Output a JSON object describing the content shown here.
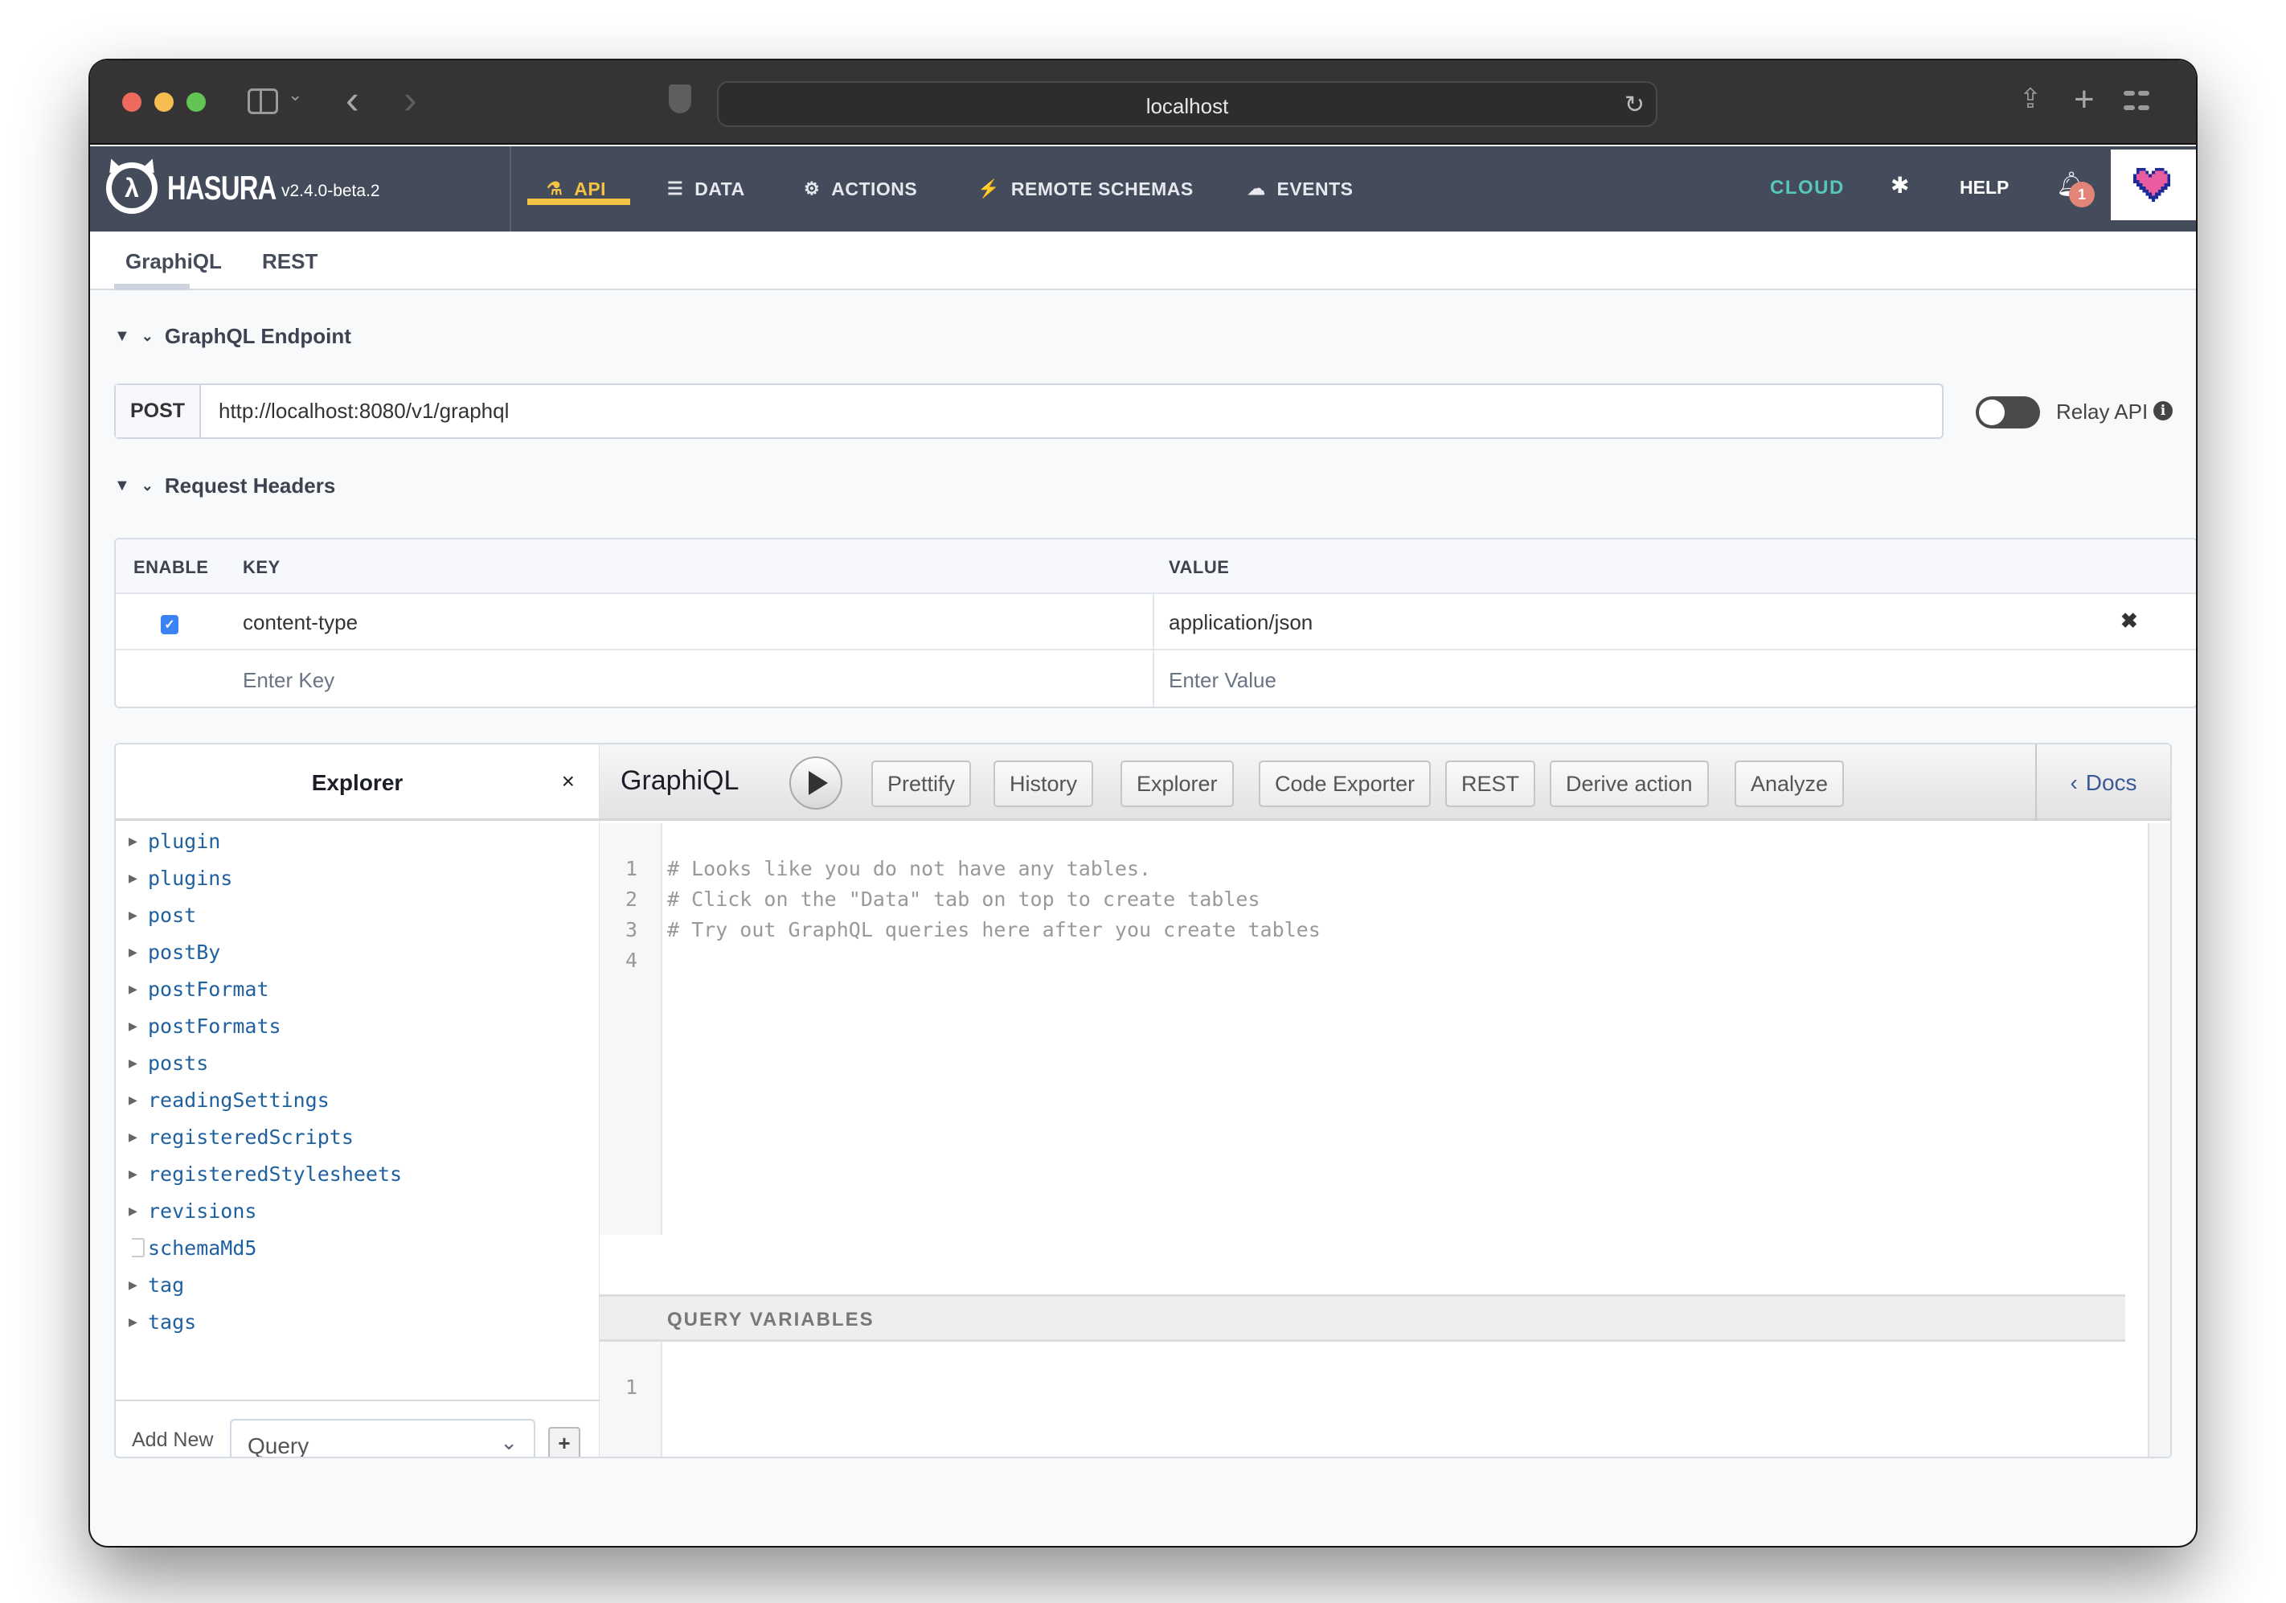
{
  "browser": {
    "url": "localhost",
    "icons": [
      "sidebar-toggle-icon",
      "chevron-down-icon",
      "back-icon",
      "forward-icon",
      "shield-icon",
      "reload-icon",
      "share-icon",
      "new-tab-icon",
      "tab-overview-icon"
    ]
  },
  "navbar": {
    "brand": "HASURA",
    "version": "v2.4.0-beta.2",
    "items": [
      {
        "label": "API",
        "icon": "flask-icon",
        "active": true
      },
      {
        "label": "DATA",
        "icon": "database-icon",
        "active": false
      },
      {
        "label": "ACTIONS",
        "icon": "cogs-icon",
        "active": false
      },
      {
        "label": "REMOTE SCHEMAS",
        "icon": "plug-icon",
        "active": false
      },
      {
        "label": "EVENTS",
        "icon": "cloud-icon",
        "active": false
      }
    ],
    "cloud": "CLOUD",
    "help": "HELP",
    "notification_count": "1",
    "accent": "#f5c344",
    "cloud_color": "#58c7bb"
  },
  "subtabs": [
    {
      "label": "GraphiQL",
      "active": true
    },
    {
      "label": "REST",
      "active": false
    }
  ],
  "endpoint": {
    "section_title": "GraphQL Endpoint",
    "method": "POST",
    "url": "http://localhost:8080/v1/graphql",
    "relay_label": "Relay API",
    "relay_enabled": false
  },
  "headers": {
    "section_title": "Request Headers",
    "columns": [
      "ENABLE",
      "KEY",
      "VALUE"
    ],
    "rows": [
      {
        "enabled": true,
        "key": "content-type",
        "value": "application/json"
      }
    ],
    "new_key_placeholder": "Enter Key",
    "new_value_placeholder": "Enter Value"
  },
  "explorer": {
    "title": "Explorer",
    "close": "×",
    "items": [
      {
        "name": "plugin",
        "expandable": true
      },
      {
        "name": "plugins",
        "expandable": true
      },
      {
        "name": "post",
        "expandable": true
      },
      {
        "name": "postBy",
        "expandable": true
      },
      {
        "name": "postFormat",
        "expandable": true
      },
      {
        "name": "postFormats",
        "expandable": true
      },
      {
        "name": "posts",
        "expandable": true
      },
      {
        "name": "readingSettings",
        "expandable": true
      },
      {
        "name": "registeredScripts",
        "expandable": true
      },
      {
        "name": "registeredStylesheets",
        "expandable": true
      },
      {
        "name": "revisions",
        "expandable": true
      },
      {
        "name": "schemaMd5",
        "expandable": false
      },
      {
        "name": "tag",
        "expandable": true
      },
      {
        "name": "tags",
        "expandable": true
      }
    ],
    "add_new_label": "Add New",
    "add_new_selected": "Query",
    "add_button": "+"
  },
  "graphiql": {
    "title": "GraphiQL",
    "buttons": [
      "Prettify",
      "History",
      "Explorer",
      "Code Exporter",
      "REST",
      "Derive action",
      "Analyze"
    ],
    "docs": "Docs",
    "editor_lines": [
      "# Looks like you do not have any tables.",
      "# Click on the \"Data\" tab on top to create tables",
      "# Try out GraphQL queries here after you create tables",
      ""
    ],
    "query_variables_title": "QUERY VARIABLES",
    "variables_lines": [
      ""
    ]
  }
}
